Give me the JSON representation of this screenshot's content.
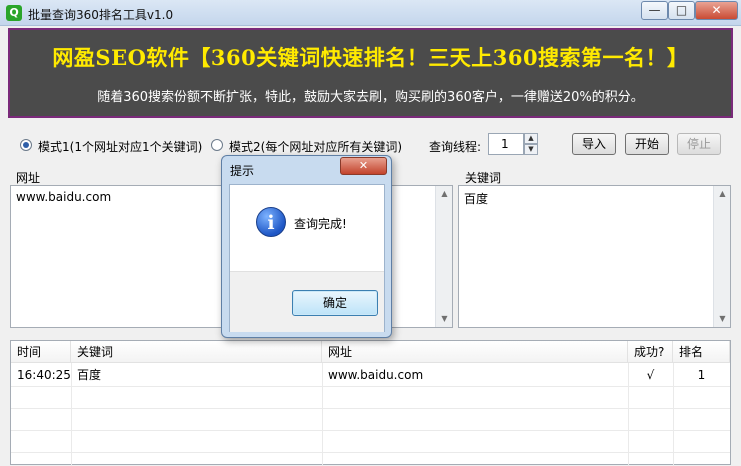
{
  "window": {
    "title": "批量查询360排名工具v1.0",
    "icon_glyph": "Q",
    "minimize": "—",
    "maximize": "□",
    "close": "✕"
  },
  "banner": {
    "headline": "网盈SEO软件【360关键词快速排名！三天上360搜索第一名！】",
    "subline": "随着360搜索份额不断扩张，特此，鼓励大家去刷，购买刷的360客户，一律赠送20%的积分。"
  },
  "options": {
    "mode1_label": "模式1(1个网址对应1个关键词)",
    "mode2_label": "模式2(每个网址对应所有关键词)",
    "selected_mode": 1,
    "threads_label": "查询线程:",
    "threads_value": "1",
    "import_label": "导入",
    "start_label": "开始",
    "stop_label": "停止"
  },
  "url_panel": {
    "label": "网址",
    "content": "www.baidu.com"
  },
  "keyword_panel": {
    "label": "关键词",
    "content": "百度"
  },
  "results_table": {
    "columns": [
      "时间",
      "关键词",
      "网址",
      "成功?",
      "排名"
    ],
    "rows": [
      [
        "16:40:25",
        "百度",
        "www.baidu.com",
        "√",
        "1"
      ]
    ]
  },
  "dialog": {
    "title": "提示",
    "close": "✕",
    "icon_glyph": "i",
    "message": "查询完成!",
    "ok_label": "确定"
  }
}
